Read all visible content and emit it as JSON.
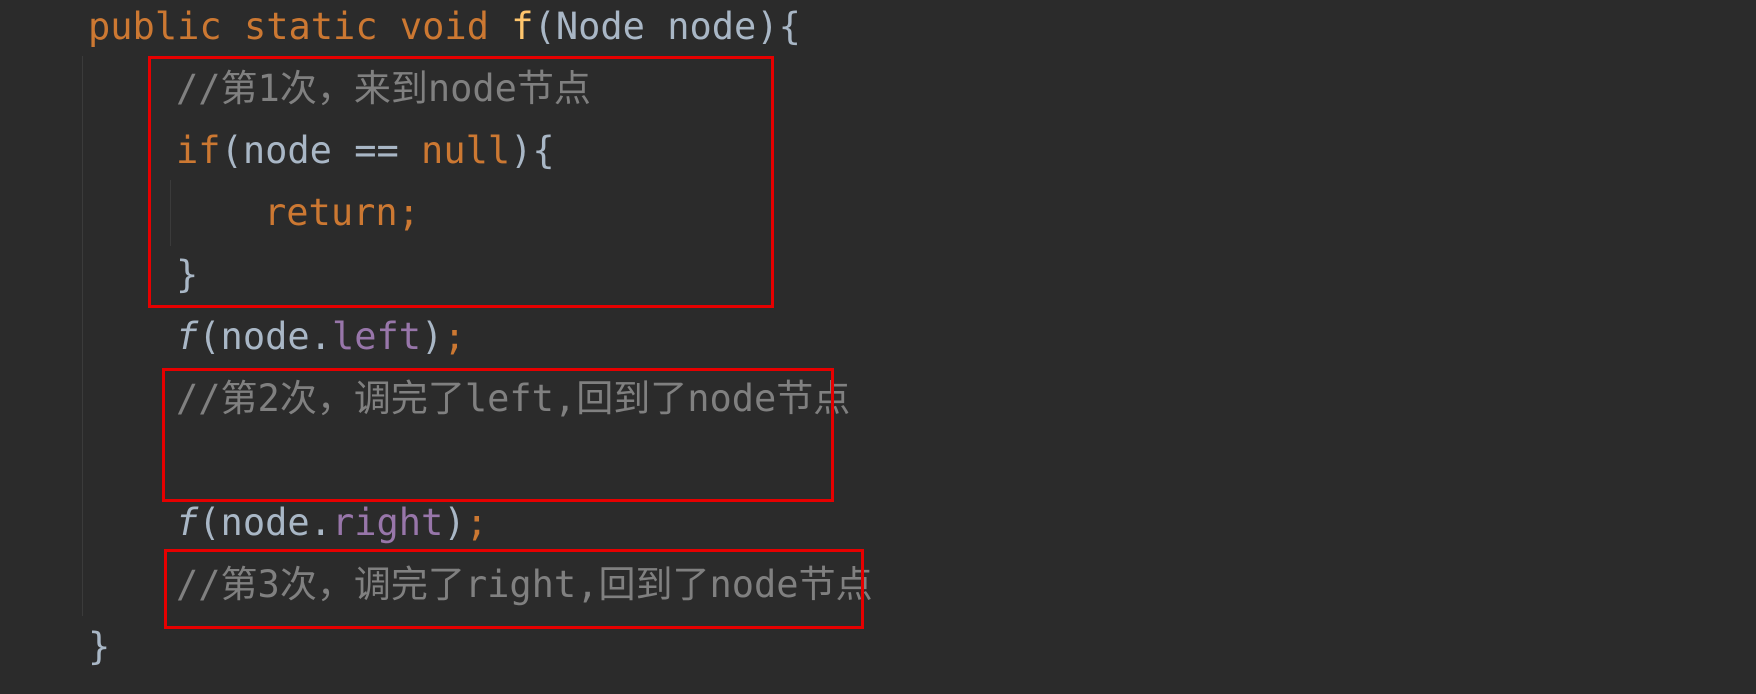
{
  "editor": {
    "lines": {
      "signature": {
        "kw_public": "public",
        "kw_static": "static",
        "kw_void": "void",
        "method": "f",
        "open_paren": "(",
        "param_type": "Node",
        "param_name": "node",
        "close": "){"
      },
      "comment1": "//第1次，来到node节点",
      "if_line": {
        "kw_if": "if",
        "cond_start": "(node == ",
        "kw_null": "null",
        "cond_end": "){"
      },
      "return_line": "return;",
      "close_if": "}",
      "call_left": {
        "fn": "f",
        "args_start": "(node.",
        "field": "left",
        "args_end": ")",
        "semi": ";"
      },
      "comment2": "//第2次，调完了left,回到了node节点",
      "call_right": {
        "fn": "f",
        "args_start": "(node.",
        "field": "right",
        "args_end": ")",
        "semi": ";"
      },
      "comment3": "//第3次，调完了right,回到了node节点",
      "close_method": "}"
    }
  },
  "colors": {
    "background": "#2b2b2b",
    "keyword": "#cc7832",
    "method_decl": "#ffc66d",
    "field": "#9876aa",
    "comment": "#808080",
    "text": "#a9b7c6",
    "highlight_box": "#e60000"
  }
}
